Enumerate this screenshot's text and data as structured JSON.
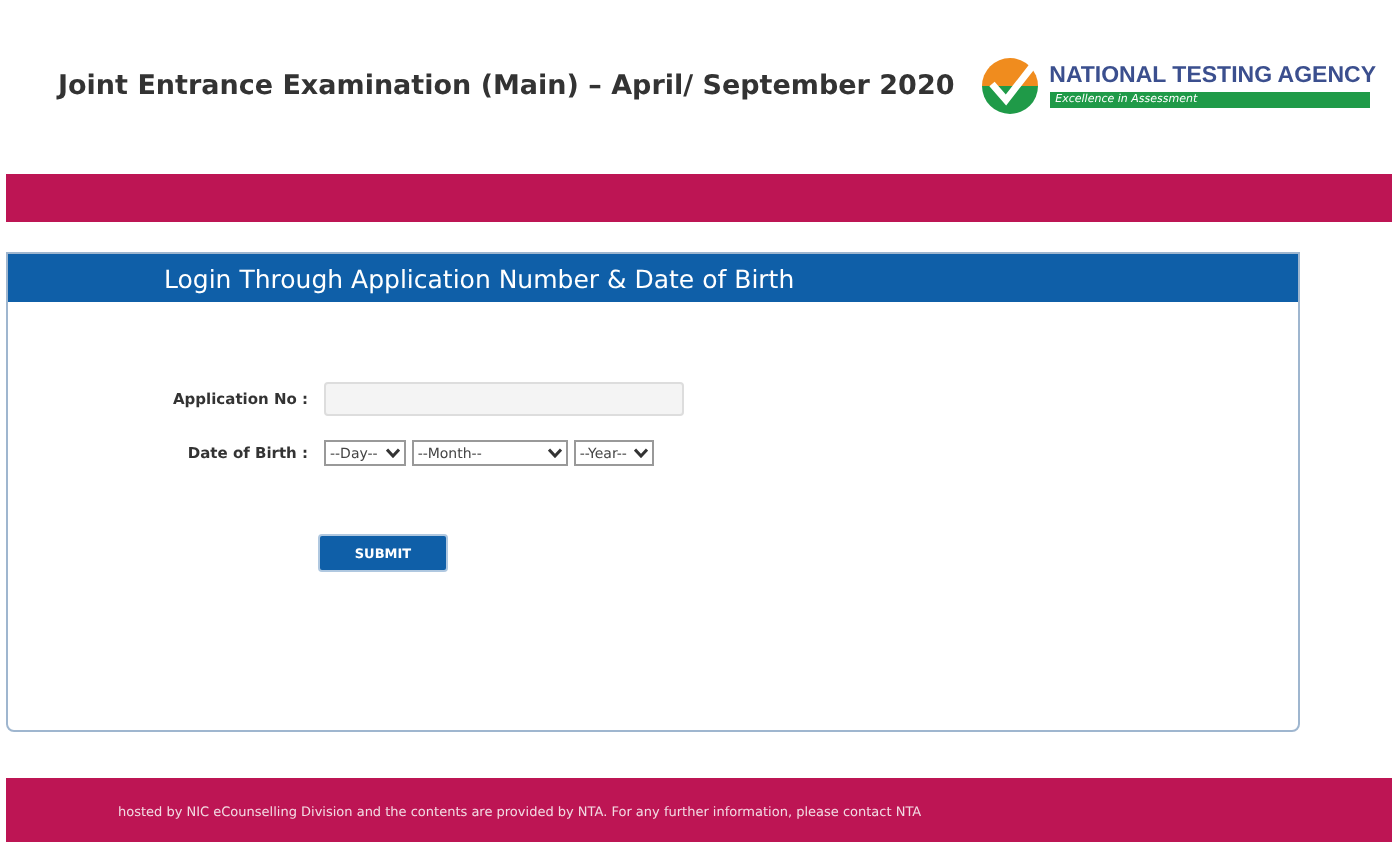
{
  "header": {
    "title": "Joint Entrance Examination (Main) – April/ September 2020",
    "logo": {
      "name": "NATIONAL TESTING AGENCY",
      "tagline": "Excellence in Assessment"
    }
  },
  "panel": {
    "title": "Login Through Application Number & Date of Birth",
    "fields": [
      {
        "kind": "text",
        "label": "Application No :"
      },
      {
        "kind": "selects",
        "label": "Date of Birth :",
        "options": [
          "--Day--",
          "--Month--",
          "--Year--"
        ]
      }
    ],
    "submit": "SUBMIT"
  },
  "footer": "hosted by NIC eCounselling Division and the contents are provided by NTA. For any further information, please contact NTA"
}
